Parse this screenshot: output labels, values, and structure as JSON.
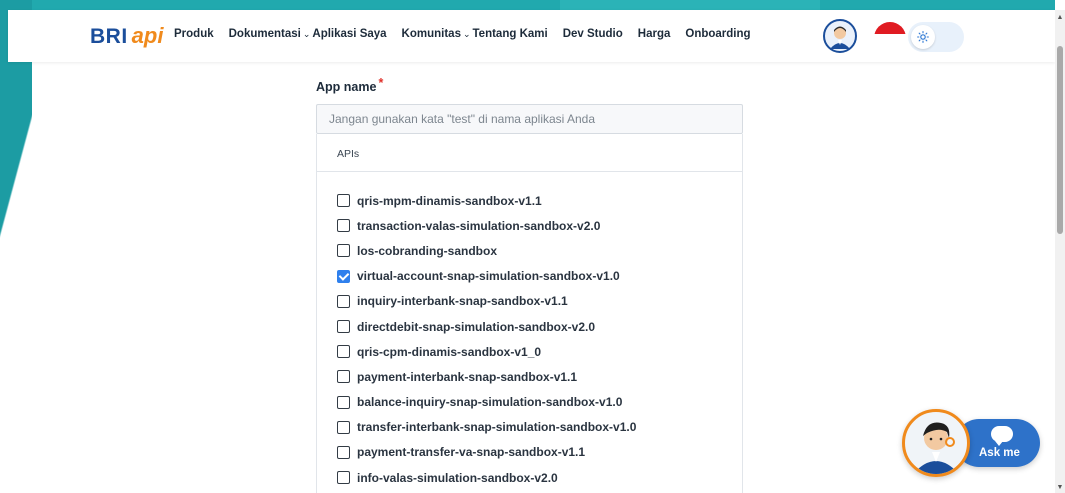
{
  "logo": {
    "primary": "BRI",
    "secondary": "api"
  },
  "nav": [
    {
      "label": "Produk",
      "has_dropdown": false
    },
    {
      "label": "Dokumentasi",
      "has_dropdown": true
    },
    {
      "label": "Aplikasi Saya",
      "has_dropdown": false
    },
    {
      "label": "Komunitas",
      "has_dropdown": true
    },
    {
      "label": "Tentang Kami",
      "has_dropdown": false
    },
    {
      "label": "Dev Studio",
      "has_dropdown": false
    },
    {
      "label": "Harga",
      "has_dropdown": false
    },
    {
      "label": "Onboarding",
      "has_dropdown": false
    }
  ],
  "header_controls": {
    "avatar_icon": "user-avatar-icon",
    "language_flag": "indonesia-flag-icon",
    "theme_icon": "sun-icon"
  },
  "form": {
    "app_name_label": "App name",
    "required_mark": "*",
    "app_name_value": "",
    "app_name_placeholder": "Jangan gunakan kata \"test\" di nama aplikasi Anda",
    "apis_label": "APIs",
    "apis": [
      {
        "label": "qris-mpm-dinamis-sandbox-v1.1",
        "checked": false
      },
      {
        "label": "transaction-valas-simulation-sandbox-v2.0",
        "checked": false
      },
      {
        "label": "los-cobranding-sandbox",
        "checked": false
      },
      {
        "label": "virtual-account-snap-simulation-sandbox-v1.0",
        "checked": true
      },
      {
        "label": "inquiry-interbank-snap-sandbox-v1.1",
        "checked": false
      },
      {
        "label": "directdebit-snap-simulation-sandbox-v2.0",
        "checked": false
      },
      {
        "label": "qris-cpm-dinamis-sandbox-v1_0",
        "checked": false
      },
      {
        "label": "payment-interbank-snap-sandbox-v1.1",
        "checked": false
      },
      {
        "label": "balance-inquiry-snap-simulation-sandbox-v1.0",
        "checked": false
      },
      {
        "label": "transfer-interbank-snap-simulation-sandbox-v1.0",
        "checked": false
      },
      {
        "label": "payment-transfer-va-snap-sandbox-v1.1",
        "checked": false
      },
      {
        "label": "info-valas-simulation-sandbox-v2.0",
        "checked": false
      }
    ]
  },
  "chat_widget": {
    "label": "Ask me",
    "icon": "chat-bubble-icon"
  },
  "colors": {
    "brand_blue": "#1b4e9b",
    "brand_orange": "#f08a1c",
    "teal_background": "#21a9ae",
    "checkbox_checked": "#2f80ed",
    "required_red": "#e0312b",
    "chat_blue": "#2e72c9"
  }
}
